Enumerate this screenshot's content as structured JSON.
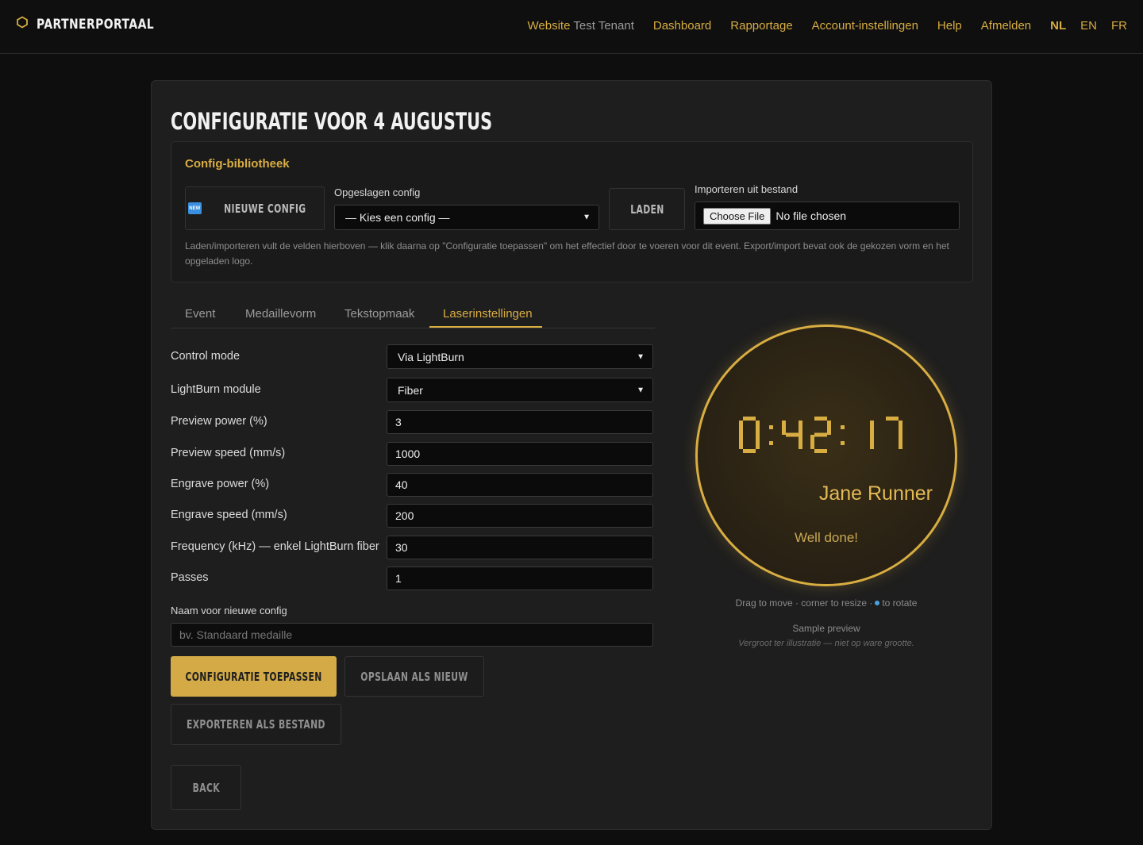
{
  "brand": {
    "name": "PARTNERPORTAAL",
    "icon": "hexagon-icon"
  },
  "nav": {
    "website_label": "Website",
    "tenant": "Test Tenant",
    "items": [
      "Dashboard",
      "Rapportage",
      "Account-instellingen",
      "Help",
      "Afmelden"
    ],
    "languages": [
      "NL",
      "EN",
      "FR"
    ],
    "active_language": "NL"
  },
  "page": {
    "title": "CONFIGURATIE VOOR 4 AUGUSTUS"
  },
  "library": {
    "title": "Config-bibliotheek",
    "new_config_label": "NIEUWE CONFIG",
    "new_badge": "NEW",
    "saved_label": "Opgeslagen config",
    "saved_selected": "— Kies een config —",
    "load_label": "LADEN",
    "import_label": "Importeren uit bestand",
    "choose_file": "Choose File",
    "no_file": "No file chosen",
    "note": "Laden/importeren vult de velden hierboven — klik daarna op \"Configuratie toepassen\" om het effectief door te voeren voor dit event. Export/import bevat ook de gekozen vorm en het opgeladen logo."
  },
  "tabs": [
    {
      "label": "Event",
      "active": false
    },
    {
      "label": "Medaillevorm",
      "active": false
    },
    {
      "label": "Tekstopmaak",
      "active": false
    },
    {
      "label": "Laserinstellingen",
      "active": true
    }
  ],
  "form": {
    "control_mode": {
      "label": "Control mode",
      "value": "Via LightBurn"
    },
    "lightburn_module": {
      "label": "LightBurn module",
      "value": "Fiber"
    },
    "preview_power": {
      "label": "Preview power (%)",
      "value": "3"
    },
    "preview_speed": {
      "label": "Preview speed (mm/s)",
      "value": "1000"
    },
    "engrave_power": {
      "label": "Engrave power (%)",
      "value": "40"
    },
    "engrave_speed": {
      "label": "Engrave speed (mm/s)",
      "value": "200"
    },
    "frequency": {
      "label": "Frequency (kHz) — enkel LightBurn fiber",
      "value": "30"
    },
    "passes": {
      "label": "Passes",
      "value": "1"
    },
    "new_name": {
      "label": "Naam voor nieuwe config",
      "placeholder": "bv. Standaard medaille"
    }
  },
  "actions": {
    "apply": "CONFIGURATIE TOEPASSEN",
    "save_new": "OPSLAAN ALS NIEUW",
    "export": "EXPORTEREN ALS BESTAND",
    "back": "BACK"
  },
  "preview": {
    "time": "0:42:17",
    "name": "Jane Runner",
    "message": "Well done!",
    "hint_before": "Drag to move · corner to resize ·",
    "hint_after": "to rotate",
    "sample_label": "Sample preview",
    "sample_note": "Vergroot ter illustratie — niet op ware grootte."
  },
  "colors": {
    "accent": "#d8ad42",
    "background": "#0e0e0e",
    "card": "#1e1e1e",
    "rotate_dot": "#4aa3df"
  }
}
